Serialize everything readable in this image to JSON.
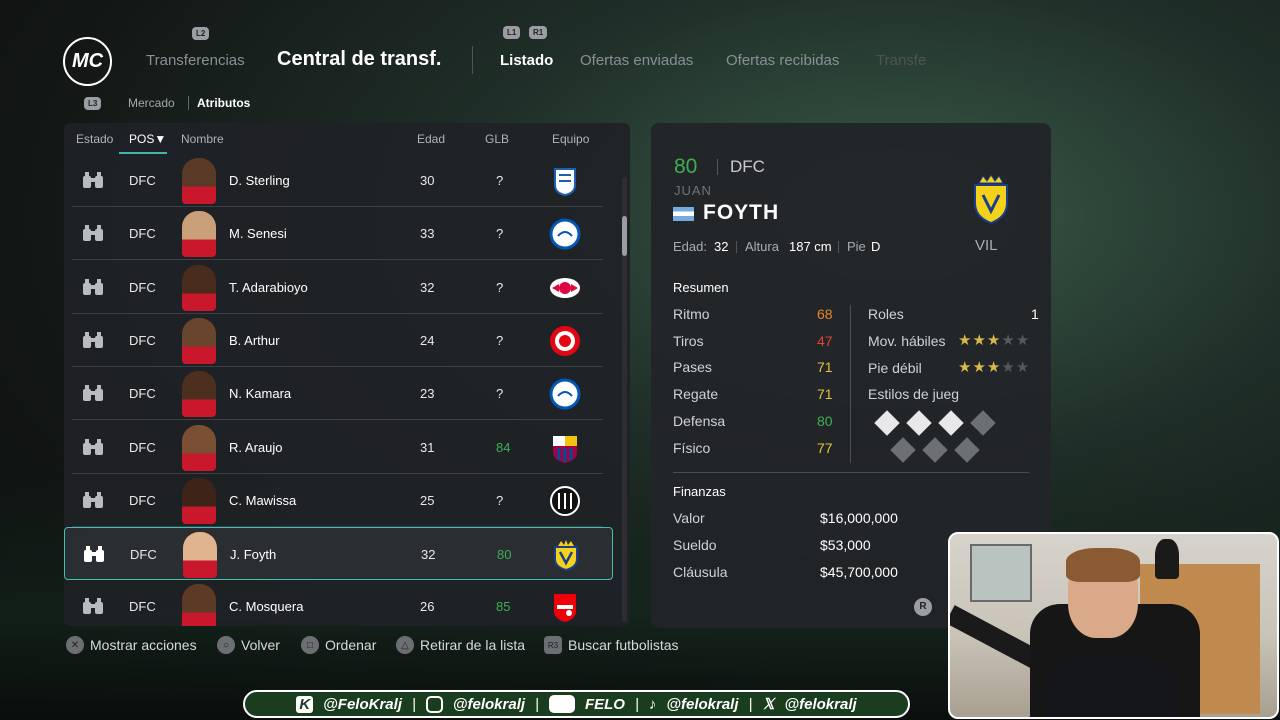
{
  "header": {
    "logo_text": "MC",
    "l2_hint": "L2",
    "l1_hint": "L1",
    "r1_hint": "R1",
    "l3_hint": "L3",
    "left_tab": "Transferencias",
    "title": "Central de transf.",
    "tabs": [
      "Listado",
      "Ofertas enviadas",
      "Ofertas recibidas",
      "Transfe"
    ]
  },
  "breadcrumb": {
    "inactive": "Mercado",
    "active": "Atributos"
  },
  "list": {
    "columns": [
      "Estado",
      "POS▼",
      "Nombre",
      "Edad",
      "GLB",
      "Equipo"
    ],
    "rows": [
      {
        "pos": "DFC",
        "name": "D. Sterling",
        "age": "30",
        "glb": "?",
        "club": "Club Bruges"
      },
      {
        "pos": "DFC",
        "name": "M. Senesi",
        "age": "33",
        "glb": "?",
        "club": "Brighton"
      },
      {
        "pos": "DFC",
        "name": "T. Adarabioyo",
        "age": "32",
        "glb": "?",
        "club": "RB Leipzig"
      },
      {
        "pos": "DFC",
        "name": "B. Arthur",
        "age": "24",
        "glb": "?",
        "club": "Brentford"
      },
      {
        "pos": "DFC",
        "name": "N. Kamara",
        "age": "23",
        "glb": "?",
        "club": "Brighton"
      },
      {
        "pos": "DFC",
        "name": "R. Araujo",
        "age": "31",
        "glb": "84",
        "club": "Barcelona"
      },
      {
        "pos": "DFC",
        "name": "C. Mawissa",
        "age": "25",
        "glb": "?",
        "club": "Newcastle"
      },
      {
        "pos": "DFC",
        "name": "J. Foyth",
        "age": "32",
        "glb": "80",
        "club": "Villarreal"
      },
      {
        "pos": "DFC",
        "name": "C. Mosquera",
        "age": "26",
        "glb": "85",
        "club": "Arsenal"
      }
    ],
    "selected_index": 7
  },
  "player": {
    "rating": "80",
    "position": "DFC",
    "first_name": "JUAN",
    "last_name": "FOYTH",
    "club_abbr": "VIL",
    "age_label": "Edad:",
    "age": "32",
    "height_label": "Altura",
    "height": "187 cm",
    "foot_label": "Pie",
    "foot": "D",
    "summary_title": "Resumen",
    "stats": [
      {
        "label": "Ritmo",
        "value": "68",
        "color": "#e8832b"
      },
      {
        "label": "Tiros",
        "value": "47",
        "color": "#e0443a"
      },
      {
        "label": "Pases",
        "value": "71",
        "color": "#e7c23a"
      },
      {
        "label": "Regate",
        "value": "71",
        "color": "#e7c23a"
      },
      {
        "label": "Defensa",
        "value": "80",
        "color": "#3fae52"
      },
      {
        "label": "Físico",
        "value": "77",
        "color": "#e7c23a"
      }
    ],
    "roles_label": "Roles",
    "roles_value": "1",
    "skill_label": "Mov. hábiles",
    "skill_stars": 3,
    "weak_label": "Pie débil",
    "weak_stars": 3,
    "playstyles_label": "Estilos de jueg",
    "finance_title": "Finanzas",
    "finance": [
      {
        "label": "Valor",
        "value": "$16,000,000"
      },
      {
        "label": "Sueldo",
        "value": "$53,000"
      },
      {
        "label": "Cláusula",
        "value": "$45,700,000"
      }
    ],
    "r_hint": "R"
  },
  "actions": [
    {
      "icon": "cross",
      "label": "Mostrar acciones"
    },
    {
      "icon": "circle",
      "label": "Volver"
    },
    {
      "icon": "square",
      "label": "Ordenar"
    },
    {
      "icon": "triangle",
      "label": "Retirar de la lista"
    },
    {
      "icon": "r3",
      "label": "Buscar futbolistas"
    }
  ],
  "social": {
    "kick": "@FeloKralj",
    "instagram": "@felokralj",
    "youtube": "FELO",
    "tiktok": "@felokralj",
    "x": "@felokralj"
  },
  "colors": {
    "accent": "#3fc0b0",
    "green": "#3fae52",
    "gold": "#d9b84a"
  }
}
